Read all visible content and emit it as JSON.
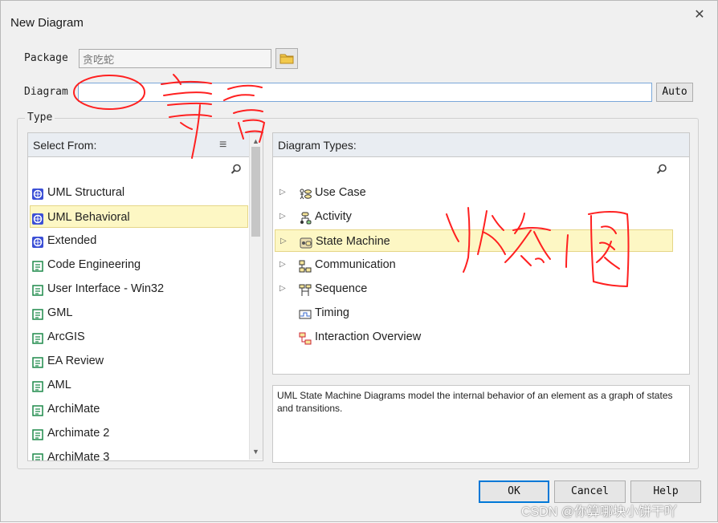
{
  "dialog": {
    "title": "New Diagram",
    "close": "✕"
  },
  "package": {
    "label": "Package",
    "value": "贪吃蛇"
  },
  "diagram": {
    "label": "Diagram",
    "value": "",
    "auto_button": "Auto"
  },
  "type_group": {
    "label": "Type"
  },
  "select_from": {
    "header": "Select From:",
    "items": [
      {
        "label": "UML Structural",
        "icon": "uml-icon"
      },
      {
        "label": "UML Behavioral",
        "icon": "uml-icon",
        "selected": true
      },
      {
        "label": "Extended",
        "icon": "uml-icon"
      },
      {
        "label": "Code Engineering",
        "icon": "toolbox-icon"
      },
      {
        "label": "User Interface - Win32",
        "icon": "toolbox-icon"
      },
      {
        "label": "GML",
        "icon": "toolbox-icon"
      },
      {
        "label": "ArcGIS",
        "icon": "toolbox-icon"
      },
      {
        "label": "EA Review",
        "icon": "toolbox-icon"
      },
      {
        "label": "AML",
        "icon": "toolbox-icon"
      },
      {
        "label": "ArchiMate",
        "icon": "toolbox-icon"
      },
      {
        "label": "Archimate 2",
        "icon": "toolbox-icon"
      },
      {
        "label": "ArchiMate 3",
        "icon": "toolbox-icon"
      }
    ]
  },
  "diagram_types": {
    "header": "Diagram Types:",
    "items": [
      {
        "label": "Use Case",
        "icon": "use-case-icon",
        "expandable": true
      },
      {
        "label": "Activity",
        "icon": "activity-icon",
        "expandable": true
      },
      {
        "label": "State Machine",
        "icon": "state-machine-icon",
        "expandable": true,
        "selected": true
      },
      {
        "label": "Communication",
        "icon": "communication-icon",
        "expandable": true
      },
      {
        "label": "Sequence",
        "icon": "sequence-icon",
        "expandable": true
      },
      {
        "label": "Timing",
        "icon": "timing-icon",
        "expandable": false
      },
      {
        "label": "Interaction Overview",
        "icon": "interaction-overview-icon",
        "expandable": false
      }
    ]
  },
  "description": "UML State Machine Diagrams model the internal behavior of an element as a graph of states and transitions.",
  "buttons": {
    "ok": "OK",
    "cancel": "Cancel",
    "help": "Help"
  },
  "watermark": "CSDN @你算哪块小饼干吖",
  "colors": {
    "selection": "#fdf7c4",
    "ink": "#ff0000",
    "default_button": "#0078d7"
  }
}
